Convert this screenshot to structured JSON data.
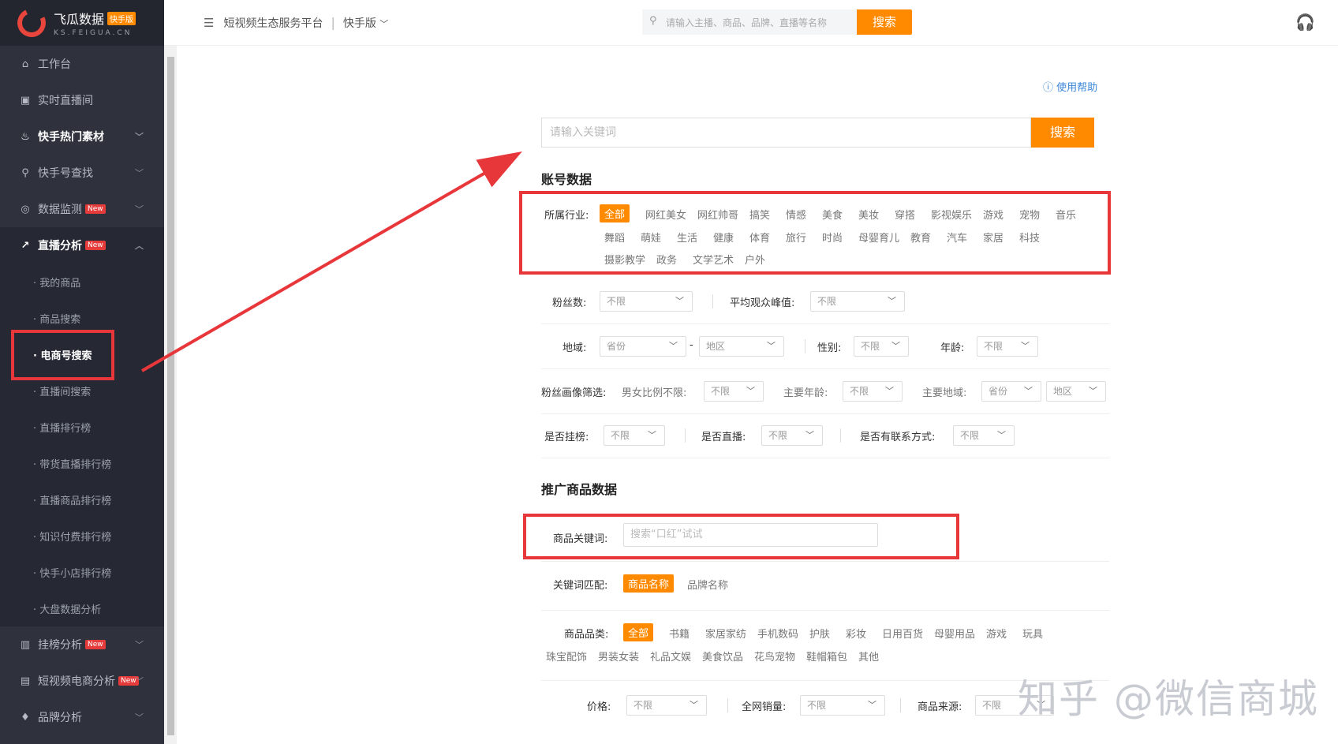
{
  "logo": {
    "name": "飞瓜数据",
    "badge": "快手版",
    "domain": "KS.FEIGUA.CN"
  },
  "sidebar": {
    "items": [
      {
        "label": "工作台"
      },
      {
        "label": "实时直播间"
      },
      {
        "label": "快手热门素材"
      },
      {
        "label": "快手号查找"
      },
      {
        "label": "数据监测",
        "new": "New"
      },
      {
        "label": "直播分析",
        "new": "New"
      },
      {
        "label": "挂榜分析",
        "new": "New"
      },
      {
        "label": "短视频电商分析",
        "new": "New"
      },
      {
        "label": "品牌分析"
      }
    ],
    "sub_items": [
      "· 我的商品",
      "· 商品搜索",
      "· 电商号搜索",
      "· 直播间搜索",
      "· 直播排行榜",
      "· 带货直播排行榜",
      "· 直播商品排行榜",
      "· 知识付费排行榜",
      "· 快手小店排行榜",
      "· 大盘数据分析"
    ]
  },
  "topbar": {
    "platform": "短视频生态服务平台",
    "version": "快手版",
    "search_placeholder": "请输入主播、商品、品牌、直播等名称",
    "search_btn": "搜索"
  },
  "help": "使用帮助",
  "keyword": {
    "placeholder": "请输入关键词",
    "btn": "搜索"
  },
  "account": {
    "title": "账号数据",
    "industry_label": "所属行业:",
    "industries": [
      "全部",
      "网红美女",
      "网红帅哥",
      "搞笑",
      "情感",
      "美食",
      "美妆",
      "穿搭",
      "影视娱乐",
      "游戏",
      "宠物",
      "音乐",
      "舞蹈",
      "萌娃",
      "生活",
      "健康",
      "体育",
      "旅行",
      "时尚",
      "母婴育儿",
      "教育",
      "汽车",
      "家居",
      "科技",
      "摄影教学",
      "政务",
      "文学艺术",
      "户外"
    ],
    "fans_label": "粉丝数:",
    "fans_value": "不限",
    "avg_peak_label": "平均观众峰值:",
    "avg_peak_value": "不限",
    "region_label": "地域:",
    "province": "省份",
    "dash": "-",
    "area": "地区",
    "gender_label": "性别:",
    "gender_value": "不限",
    "age_label": "年龄:",
    "age_value": "不限",
    "portrait_label": "粉丝画像筛选:",
    "ratio_label": "男女比例不限:",
    "ratio_value": "不限",
    "main_age_label": "主要年龄:",
    "main_age_value": "不限",
    "main_region_label": "主要地域:",
    "main_province": "省份",
    "main_area": "地区",
    "rank_label": "是否挂榜:",
    "rank_value": "不限",
    "live_label": "是否直播:",
    "live_value": "不限",
    "contact_label": "是否有联系方式:",
    "contact_value": "不限"
  },
  "promo": {
    "title": "推广商品数据",
    "kw_label": "商品关键词:",
    "kw_placeholder": "搜索“口红”试试",
    "match_label": "关键词匹配:",
    "match_options": [
      "商品名称",
      "品牌名称"
    ],
    "category_label": "商品品类:",
    "categories": [
      "全部",
      "书籍",
      "家居家纺",
      "手机数码",
      "护肤",
      "彩妆",
      "日用百货",
      "母婴用品",
      "游戏",
      "玩具",
      "珠宝配饰",
      "男装女装",
      "礼品文娱",
      "美食饮品",
      "花鸟宠物",
      "鞋帽箱包",
      "其他"
    ],
    "price_label": "价格:",
    "price_value": "不限",
    "sales_label": "全网销量:",
    "sales_value": "不限",
    "source_label": "商品来源:",
    "source_value": "不限"
  },
  "watermark": "知乎 @微信商城"
}
